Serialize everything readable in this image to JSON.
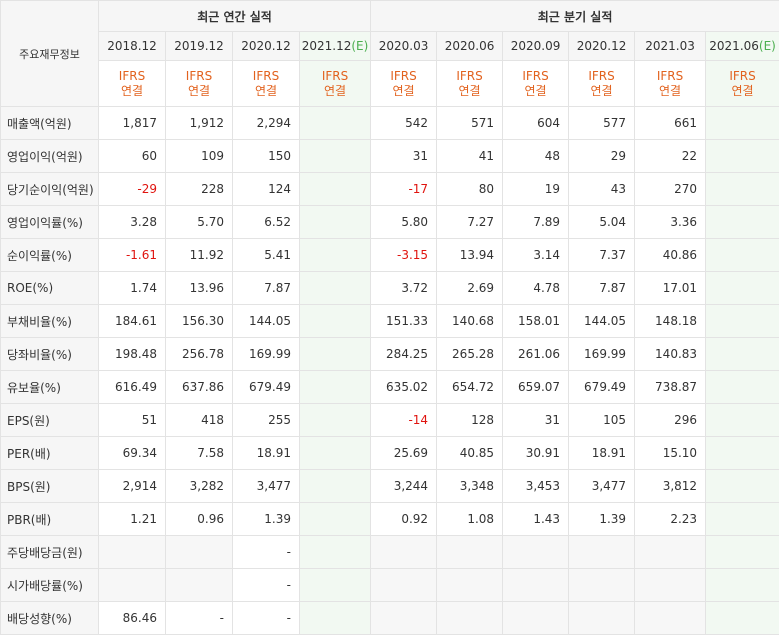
{
  "header": {
    "label_col": "주요재무정보",
    "annual_title": "최근 연간 실적",
    "quarter_title": "최근 분기 실적"
  },
  "periods": {
    "annual": [
      "2018.12",
      "2019.12",
      "2020.12",
      "2021.12"
    ],
    "annual_est_mark": "(E)",
    "quarter": [
      "2020.03",
      "2020.06",
      "2020.09",
      "2020.12",
      "2021.03",
      "2021.06"
    ],
    "quarter_est_mark": "(E)"
  },
  "ifrs": {
    "line1": "IFRS",
    "line2": "연결"
  },
  "rows": [
    {
      "label": "매출액(억원)",
      "annual": [
        "1,817",
        "1,912",
        "2,294",
        ""
      ],
      "quarter": [
        "542",
        "571",
        "604",
        "577",
        "661",
        ""
      ]
    },
    {
      "label": "영업이익(억원)",
      "annual": [
        "60",
        "109",
        "150",
        ""
      ],
      "quarter": [
        "31",
        "41",
        "48",
        "29",
        "22",
        ""
      ]
    },
    {
      "label": "당기순이익(억원)",
      "annual": [
        "-29",
        "228",
        "124",
        ""
      ],
      "quarter": [
        "-17",
        "80",
        "19",
        "43",
        "270",
        ""
      ]
    },
    {
      "label": "영업이익률(%)",
      "annual": [
        "3.28",
        "5.70",
        "6.52",
        ""
      ],
      "quarter": [
        "5.80",
        "7.27",
        "7.89",
        "5.04",
        "3.36",
        ""
      ]
    },
    {
      "label": "순이익률(%)",
      "annual": [
        "-1.61",
        "11.92",
        "5.41",
        ""
      ],
      "quarter": [
        "-3.15",
        "13.94",
        "3.14",
        "7.37",
        "40.86",
        ""
      ]
    },
    {
      "label": "ROE(%)",
      "annual": [
        "1.74",
        "13.96",
        "7.87",
        ""
      ],
      "quarter": [
        "3.72",
        "2.69",
        "4.78",
        "7.87",
        "17.01",
        ""
      ]
    },
    {
      "label": "부채비율(%)",
      "annual": [
        "184.61",
        "156.30",
        "144.05",
        ""
      ],
      "quarter": [
        "151.33",
        "140.68",
        "158.01",
        "144.05",
        "148.18",
        ""
      ]
    },
    {
      "label": "당좌비율(%)",
      "annual": [
        "198.48",
        "256.78",
        "169.99",
        ""
      ],
      "quarter": [
        "284.25",
        "265.28",
        "261.06",
        "169.99",
        "140.83",
        ""
      ]
    },
    {
      "label": "유보율(%)",
      "annual": [
        "616.49",
        "637.86",
        "679.49",
        ""
      ],
      "quarter": [
        "635.02",
        "654.72",
        "659.07",
        "679.49",
        "738.87",
        ""
      ]
    },
    {
      "label": "EPS(원)",
      "annual": [
        "51",
        "418",
        "255",
        ""
      ],
      "quarter": [
        "-14",
        "128",
        "31",
        "105",
        "296",
        ""
      ]
    },
    {
      "label": "PER(배)",
      "annual": [
        "69.34",
        "7.58",
        "18.91",
        ""
      ],
      "quarter": [
        "25.69",
        "40.85",
        "30.91",
        "18.91",
        "15.10",
        ""
      ]
    },
    {
      "label": "BPS(원)",
      "annual": [
        "2,914",
        "3,282",
        "3,477",
        ""
      ],
      "quarter": [
        "3,244",
        "3,348",
        "3,453",
        "3,477",
        "3,812",
        ""
      ]
    },
    {
      "label": "PBR(배)",
      "annual": [
        "1.21",
        "0.96",
        "1.39",
        ""
      ],
      "quarter": [
        "0.92",
        "1.08",
        "1.43",
        "1.39",
        "2.23",
        ""
      ]
    },
    {
      "label": "주당배당금(원)",
      "annual": [
        "",
        "",
        "-",
        ""
      ],
      "quarter": [
        "",
        "",
        "",
        "",
        "",
        ""
      ]
    },
    {
      "label": "시가배당률(%)",
      "annual": [
        "",
        "",
        "-",
        ""
      ],
      "quarter": [
        "",
        "",
        "",
        "",
        "",
        ""
      ]
    },
    {
      "label": "배당성향(%)",
      "annual": [
        "86.46",
        "-",
        "-",
        ""
      ],
      "quarter": [
        "",
        "",
        "",
        "",
        "",
        ""
      ]
    }
  ]
}
